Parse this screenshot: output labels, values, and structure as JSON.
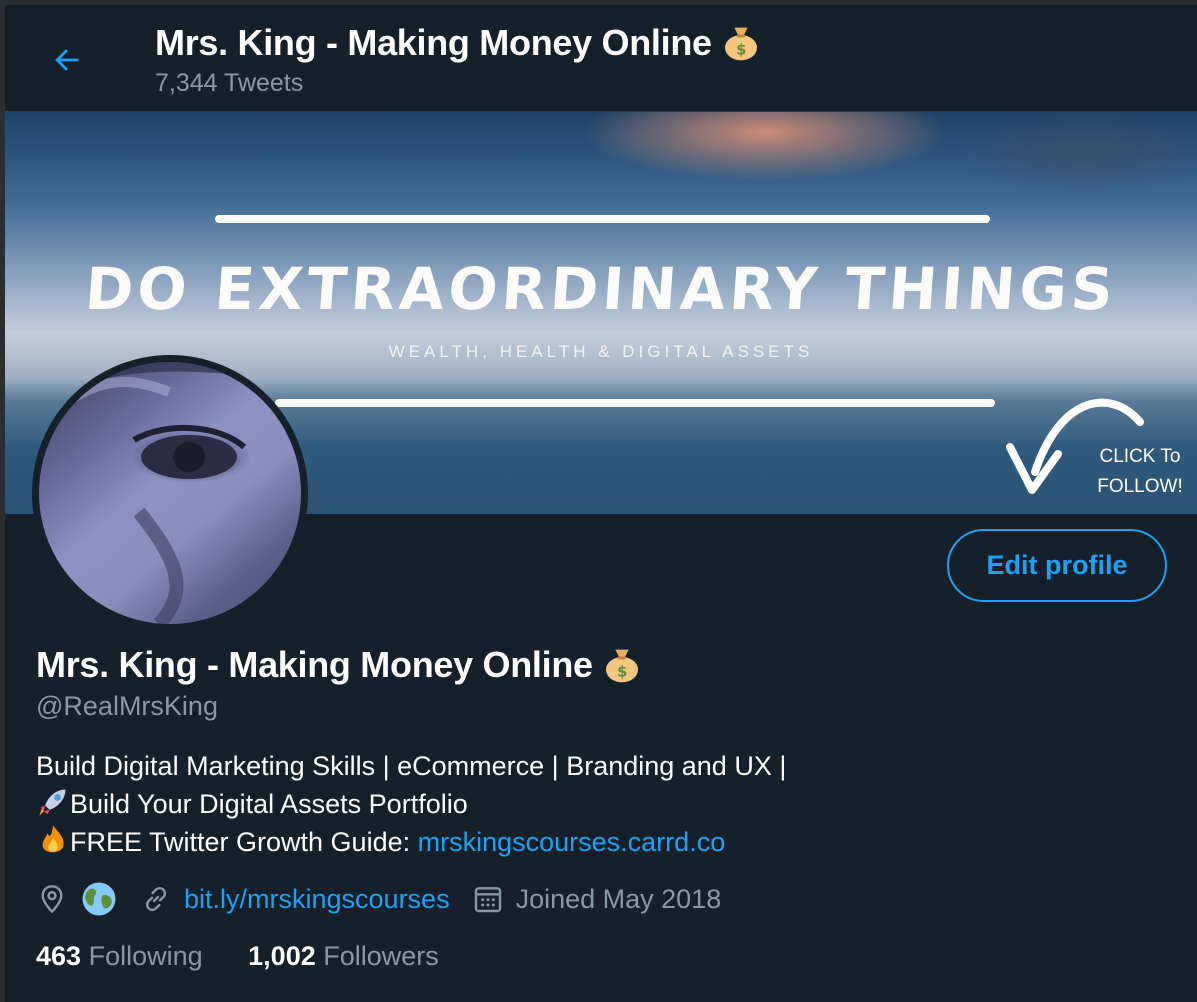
{
  "header": {
    "title": "Mrs. King - Making Money Online",
    "tweet_count": "7,344 Tweets"
  },
  "banner": {
    "headline": "DO EXTRAORDINARY THINGS",
    "tagline": "WEALTH, HEALTH & DIGITAL ASSETS",
    "cta_line1": "CLICK To",
    "cta_line2": "FOLLOW!"
  },
  "profile": {
    "edit_label": "Edit profile",
    "name": "Mrs. King - Making Money Online",
    "handle": "@RealMrsKing",
    "bio_line1": "Build Digital Marketing Skills | eCommerce | Branding and UX |",
    "bio_line2": "Build Your Digital Assets Portfolio",
    "bio_line3_text": "FREE Twitter Growth Guide: ",
    "bio_line3_link": "mrskingscourses.carrd.co",
    "website": "bit.ly/mrskingscourses",
    "joined": "Joined May 2018",
    "following_count": "463",
    "following_label": "Following",
    "followers_count": "1,002",
    "followers_label": "Followers"
  },
  "icons": {
    "back": "arrow-left-icon",
    "name_emoji": "money-bag-icon",
    "location": "location-pin-icon",
    "globe": "globe-icon",
    "link": "link-icon",
    "calendar": "calendar-icon",
    "rocket": "rocket-icon",
    "fire": "fire-icon"
  },
  "colors": {
    "background": "#15202b",
    "accent": "#1da1f2",
    "secondary_text": "#8899a6",
    "border": "#38444d"
  }
}
